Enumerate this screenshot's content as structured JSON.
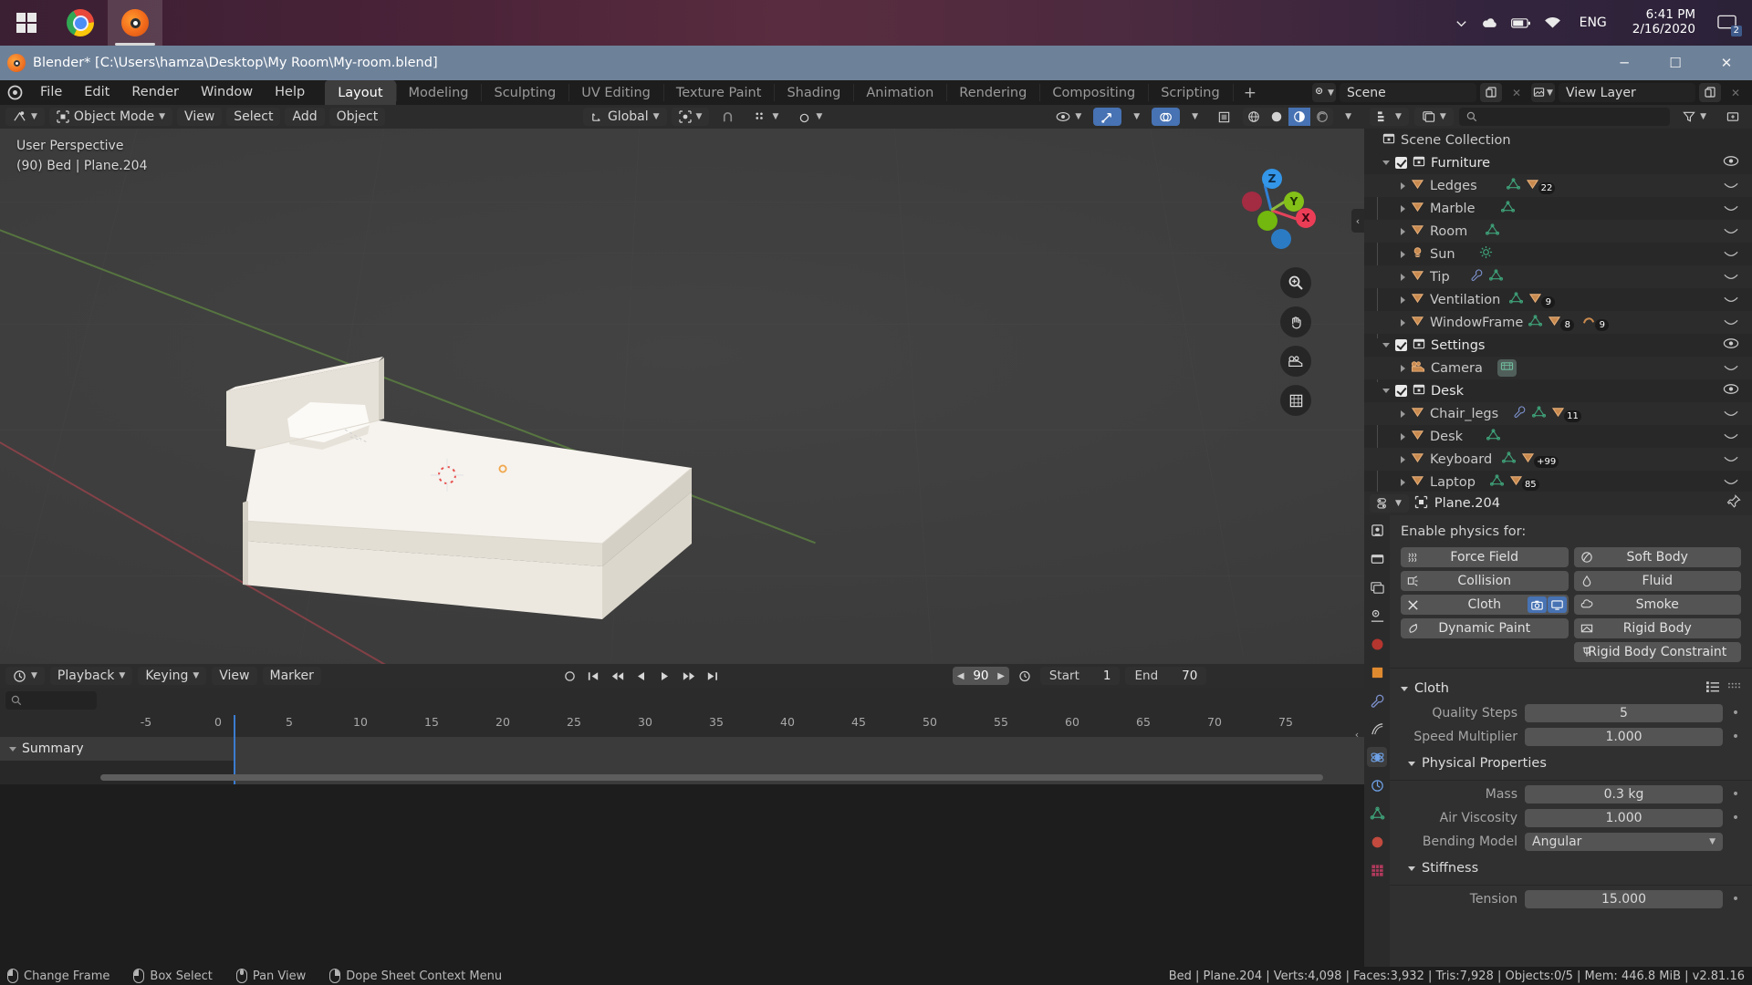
{
  "taskbar": {
    "start_label": "Start",
    "apps": [
      {
        "name": "chrome",
        "label": "Google Chrome"
      },
      {
        "name": "blender",
        "label": "Blender",
        "active": true
      }
    ],
    "language": "ENG",
    "time": "6:41 PM",
    "date": "2/16/2020",
    "notification_count": "2"
  },
  "window": {
    "title": "Blender* [C:\\Users\\hamza\\Desktop\\My Room\\My-room.blend]",
    "minimize": "─",
    "maximize": "☐",
    "close": "✕"
  },
  "topbar": {
    "menus": [
      "File",
      "Edit",
      "Render",
      "Window",
      "Help"
    ],
    "workspaces": [
      "Layout",
      "Modeling",
      "Sculpting",
      "UV Editing",
      "Texture Paint",
      "Shading",
      "Animation",
      "Rendering",
      "Compositing",
      "Scripting"
    ],
    "active_workspace": "Layout",
    "add_workspace": "+",
    "scene_name": "Scene",
    "view_layer_name": "View Layer"
  },
  "viewport": {
    "mode": "Object Mode",
    "menus": [
      "View",
      "Select",
      "Add",
      "Object"
    ],
    "transform_orientation": "Global",
    "overlay_text_line1": "User Perspective",
    "overlay_text_line2": "(90) Bed | Plane.204",
    "gizmo_axes": [
      "X",
      "Y",
      "Z"
    ],
    "shading_modes": [
      "wireframe",
      "solid",
      "material-preview",
      "rendered"
    ],
    "active_shading": "material-preview"
  },
  "outliner": {
    "search_placeholder": "",
    "root": "Scene Collection",
    "rows": [
      {
        "label": "Furniture",
        "type": "collection",
        "depth": 0,
        "checked": true,
        "eye": true
      },
      {
        "label": "Ledges",
        "type": "object",
        "depth": 1,
        "data": [
          "mesh"
        ],
        "modifier_count": "22"
      },
      {
        "label": "Marble",
        "type": "object",
        "depth": 1,
        "data": [
          "mesh"
        ]
      },
      {
        "label": "Room",
        "type": "object",
        "depth": 1,
        "data": [
          "mesh"
        ]
      },
      {
        "label": "Sun",
        "type": "light",
        "depth": 1,
        "data": [
          "light"
        ]
      },
      {
        "label": "Tip",
        "type": "object",
        "depth": 1,
        "data": [
          "modifier",
          "mesh"
        ]
      },
      {
        "label": "Ventilation",
        "type": "object",
        "depth": 1,
        "data": [
          "mesh"
        ],
        "modifier_count": "9"
      },
      {
        "label": "WindowFrame",
        "type": "object",
        "depth": 1,
        "data": [
          "mesh"
        ],
        "modifier_count": "8",
        "extra_count": "9"
      },
      {
        "label": "Settings",
        "type": "collection",
        "depth": 0,
        "checked": true,
        "eye": true
      },
      {
        "label": "Camera",
        "type": "camera",
        "depth": 1,
        "data": [
          "camera"
        ]
      },
      {
        "label": "Desk",
        "type": "collection",
        "depth": 0,
        "checked": true,
        "eye": true
      },
      {
        "label": "Chair_legs",
        "type": "object",
        "depth": 1,
        "data": [
          "modifier",
          "mesh"
        ],
        "modifier_count": "11"
      },
      {
        "label": "Desk",
        "type": "object",
        "depth": 1,
        "data": [
          "mesh"
        ]
      },
      {
        "label": "Keyboard",
        "type": "object",
        "depth": 1,
        "data": [
          "mesh"
        ],
        "modifier_count": "+99"
      },
      {
        "label": "Laptop",
        "type": "object",
        "depth": 1,
        "data": [
          "mesh"
        ],
        "modifier_count": "85"
      }
    ]
  },
  "properties": {
    "object_name": "Plane.204",
    "enable_label": "Enable physics for:",
    "physics_buttons": [
      {
        "label": "Force Field",
        "icon": "force-field-icon",
        "column": "left"
      },
      {
        "label": "Soft Body",
        "icon": "soft-body-icon",
        "column": "right"
      },
      {
        "label": "Collision",
        "icon": "collision-icon",
        "column": "left"
      },
      {
        "label": "Fluid",
        "icon": "fluid-icon",
        "column": "right"
      },
      {
        "label": "Cloth",
        "icon": "close-icon",
        "column": "left",
        "enabled": true
      },
      {
        "label": "Smoke",
        "icon": "smoke-icon",
        "column": "right"
      },
      {
        "label": "Dynamic Paint",
        "icon": "dynamic-paint-icon",
        "column": "left"
      },
      {
        "label": "Rigid Body",
        "icon": "rigid-body-icon",
        "column": "right"
      },
      {
        "label": "Rigid Body Constraint",
        "icon": "rigid-body-constraint-icon",
        "column": "right"
      }
    ],
    "panels": {
      "cloth_title": "Cloth",
      "cloth_fields": [
        {
          "label": "Quality Steps",
          "value": "5"
        },
        {
          "label": "Speed Multiplier",
          "value": "1.000"
        }
      ],
      "physical_title": "Physical Properties",
      "physical_fields": [
        {
          "label": "Mass",
          "value": "0.3 kg"
        },
        {
          "label": "Air Viscosity",
          "value": "1.000"
        }
      ],
      "bending_label": "Bending Model",
      "bending_value": "Angular",
      "stiffness_title": "Stiffness",
      "stiffness_fields": [
        {
          "label": "Tension",
          "value": "15.000"
        }
      ]
    }
  },
  "timeline": {
    "menus": [
      "Playback",
      "Keying",
      "View",
      "Marker"
    ],
    "current_frame": "90",
    "start_label": "Start",
    "start_value": "1",
    "end_label": "End",
    "end_value": "70",
    "summary_label": "Summary",
    "ruler_ticks": [
      "-5",
      "0",
      "5",
      "10",
      "15",
      "20",
      "25",
      "30",
      "35",
      "40",
      "45",
      "50",
      "55",
      "60",
      "65",
      "70",
      "75"
    ]
  },
  "statusbar": {
    "hints": [
      {
        "mouse": "left",
        "label": "Change Frame"
      },
      {
        "mouse": "left2",
        "label": "Box Select"
      },
      {
        "mouse": "middle",
        "label": "Pan View"
      },
      {
        "mouse": "right",
        "label": "Dope Sheet Context Menu"
      }
    ],
    "stats": "Bed | Plane.204 | Verts:4,098 | Faces:3,932 | Tris:7,928 | Objects:0/5 | Mem: 446.8 MiB | v2.81.16"
  },
  "colors": {
    "accent": "#4772b3",
    "mesh": "#d79a63",
    "data": "#3fa37a",
    "titlebar": "#6d8199"
  }
}
